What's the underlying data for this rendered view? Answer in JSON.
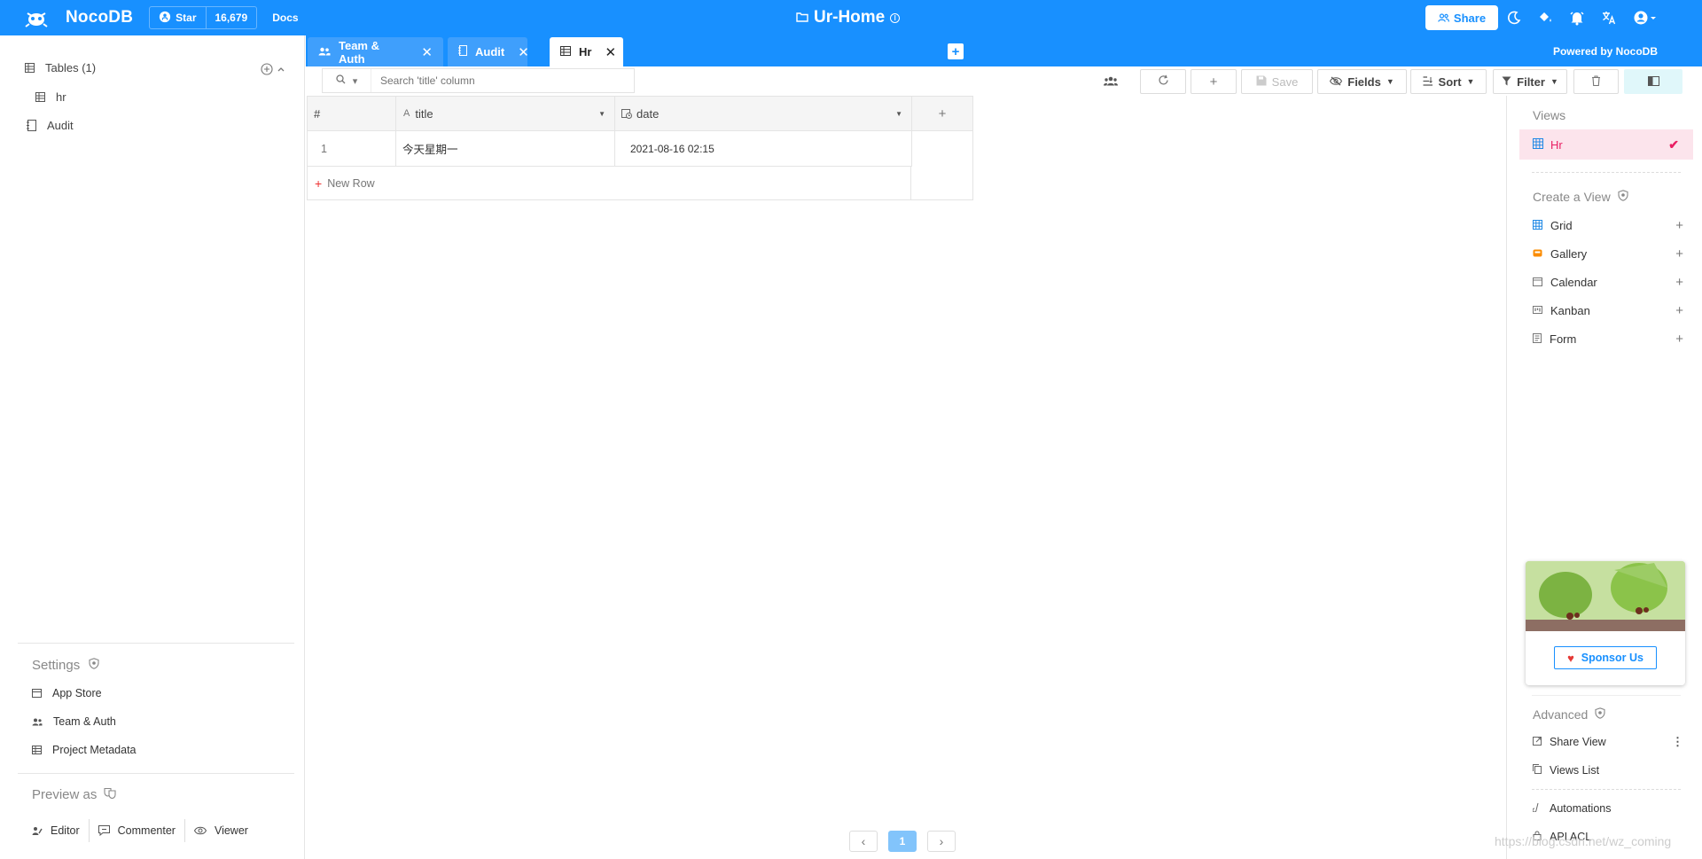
{
  "topbar": {
    "brand": "NocoDB",
    "github_star_label": "Star",
    "github_star_count": "16,679",
    "docs_label": "Docs",
    "project_name": "Ur-Home",
    "share_label": "Share",
    "icons": [
      "theme-toggle-icon",
      "paint-bucket-icon",
      "bell-icon",
      "translate-icon",
      "account-icon"
    ]
  },
  "sidebar": {
    "tables_header": "Tables (1)",
    "tables": [
      {
        "name": "hr"
      }
    ],
    "audit_label": "Audit",
    "settings_title": "Settings",
    "settings_items": [
      {
        "label": "App Store"
      },
      {
        "label": "Team & Auth"
      },
      {
        "label": "Project Metadata"
      }
    ],
    "preview_title": "Preview as",
    "preview_roles": [
      {
        "label": "Editor"
      },
      {
        "label": "Commenter"
      },
      {
        "label": "Viewer"
      }
    ]
  },
  "tabs": [
    {
      "label": "Team & Auth",
      "active": false
    },
    {
      "label": "Audit",
      "active": false
    },
    {
      "label": "Hr",
      "active": true
    }
  ],
  "powered_by": "Powered by NocoDB",
  "toolbar": {
    "search_placeholder": "Search 'title' column",
    "save_label": "Save",
    "fields_label": "Fields",
    "sort_label": "Sort",
    "filter_label": "Filter"
  },
  "grid": {
    "columns": [
      {
        "label": "#"
      },
      {
        "label": "title"
      },
      {
        "label": "date"
      }
    ],
    "rows": [
      {
        "index": "1",
        "title": "今天星期一",
        "date": "2021-08-16 02:15"
      }
    ],
    "new_row_label": "New Row"
  },
  "pagination": {
    "current_page": "1"
  },
  "right_panel": {
    "views_title": "Views",
    "active_view": "Hr",
    "create_title": "Create a View",
    "create_items": [
      {
        "label": "Grid",
        "color": "#1e88e5"
      },
      {
        "label": "Gallery",
        "color": "#fb8c00"
      },
      {
        "label": "Calendar",
        "color": "#777777"
      },
      {
        "label": "Kanban",
        "color": "#777777"
      },
      {
        "label": "Form",
        "color": "#777777"
      }
    ],
    "sponsor_label": "Sponsor Us",
    "advanced_title": "Advanced",
    "advanced_items": [
      {
        "label": "Share View"
      },
      {
        "label": "Views List"
      },
      {
        "label": "Automations"
      },
      {
        "label": "API ACL"
      }
    ]
  },
  "watermark": "https://blog.csdn.net/wz_coming",
  "colors": {
    "primary": "#1890ff",
    "accent_pink": "#e91e63"
  }
}
